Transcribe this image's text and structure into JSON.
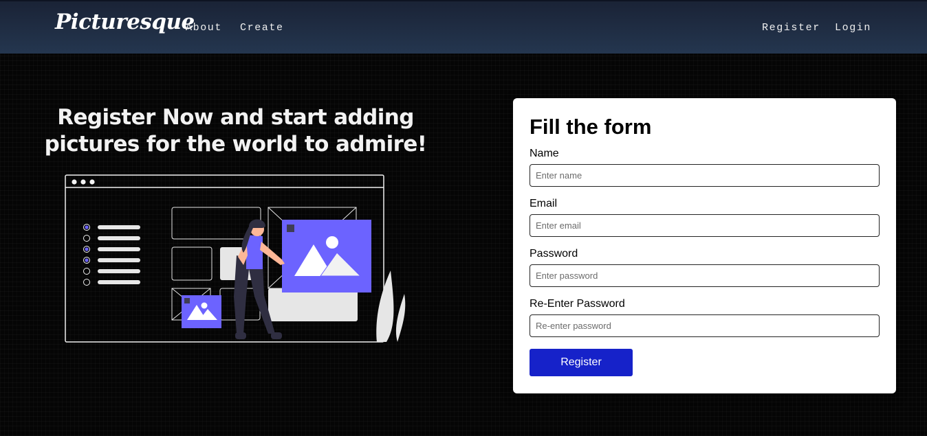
{
  "navbar": {
    "brand": "Picturesque",
    "links": [
      {
        "label": "About"
      },
      {
        "label": "Create"
      }
    ],
    "register_label": "Register",
    "login_label": "Login"
  },
  "hero": {
    "title_line1": "Register Now and start adding",
    "title_line2": "pictures for the world to admire!"
  },
  "illustration": {
    "icon": "woman-adding-picture-illustration",
    "accent_color": "#6c63ff"
  },
  "form": {
    "title": "Fill the form",
    "fields": [
      {
        "label": "Name",
        "placeholder": "Enter name",
        "value": ""
      },
      {
        "label": "Email",
        "placeholder": "Enter email",
        "value": ""
      },
      {
        "label": "Password",
        "placeholder": "Enter password",
        "value": ""
      },
      {
        "label": "Re-Enter Password",
        "placeholder": "Re-enter password",
        "value": ""
      }
    ],
    "submit_label": "Register",
    "submit_color": "#1622c9"
  }
}
